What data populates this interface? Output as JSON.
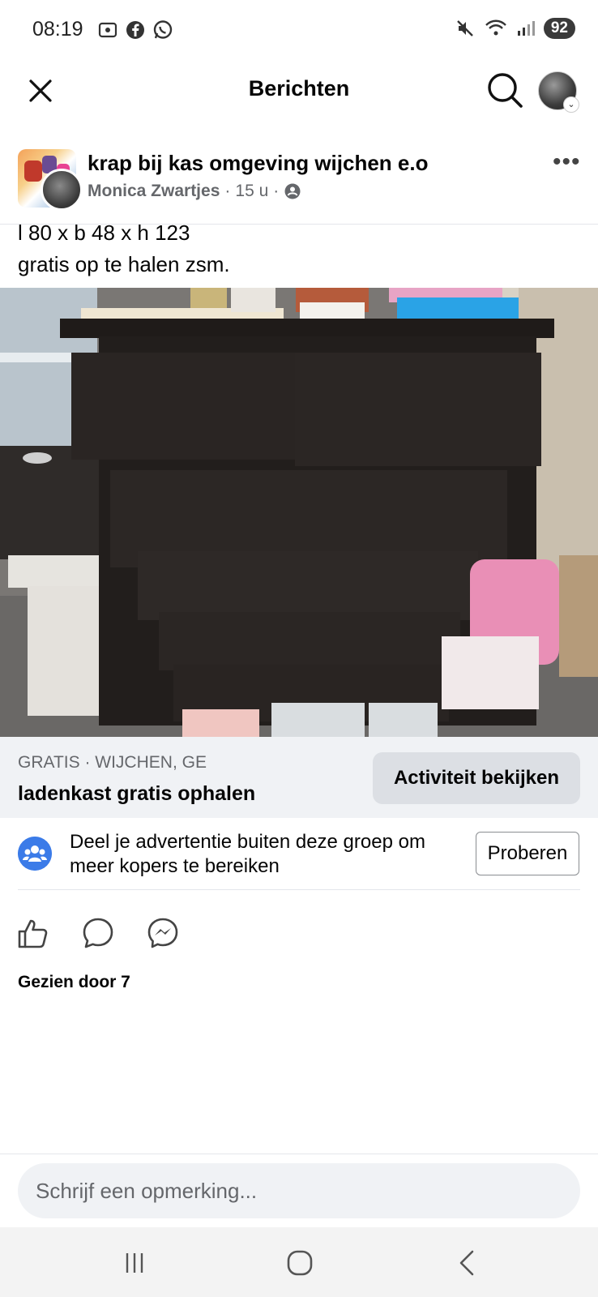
{
  "status_bar": {
    "time": "08:19",
    "battery": "92",
    "left_icons": [
      "screenshot-icon",
      "facebook-icon",
      "whatsapp-icon"
    ],
    "right_icons": [
      "mute-icon",
      "wifi-icon",
      "signal-icon"
    ]
  },
  "header": {
    "title": "Berichten",
    "close_icon": "close-icon",
    "search_icon": "search-icon"
  },
  "post": {
    "group_name": "krap bij kas omgeving wijchen e.o",
    "author": "Monica Zwartjes",
    "time": "15 u",
    "separator": "·",
    "privacy_icon": "group-privacy-icon",
    "text_line1": "l 80 x b 48 x h 123",
    "text_line2": "gratis op te halen zsm."
  },
  "listing": {
    "subtitle": "GRATIS · WIJCHEN, GE",
    "title": "ladenkast gratis ophalen",
    "activity_button": "Activiteit bekijken"
  },
  "share_prompt": {
    "text": "Deel je advertentie buiten deze groep om meer kopers te bereiken",
    "button": "Proberen"
  },
  "actions": {
    "like_icon": "like-icon",
    "comment_icon": "comment-icon",
    "messenger_icon": "messenger-icon"
  },
  "seen_by": "Gezien door 7",
  "comment": {
    "placeholder": "Schrijf een opmerking..."
  },
  "nav": {
    "recents_icon": "recents-icon",
    "home_icon": "home-icon",
    "back_icon": "back-icon"
  },
  "colors": {
    "accent": "#1877f2",
    "secondary_text": "#65676b",
    "listing_bg": "#f0f2f5"
  }
}
